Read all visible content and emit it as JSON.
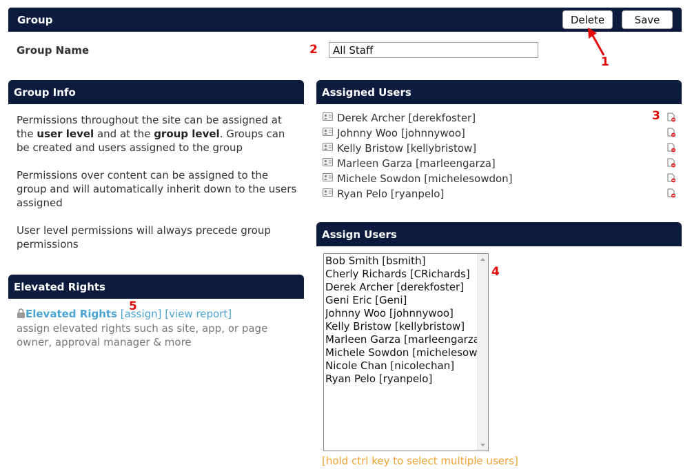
{
  "header": {
    "title": "Group",
    "delete_label": "Delete",
    "save_label": "Save"
  },
  "group_name": {
    "label": "Group Name",
    "value": "All Staff"
  },
  "group_info": {
    "title": "Group Info",
    "p1_a": "Permissions throughout the site can be assigned at the ",
    "p1_b": "user level",
    "p1_c": " and at the ",
    "p1_d": "group level",
    "p1_e": ". Groups can be created and users assigned to the group",
    "p2": "Permissions over content can be assigned to the group and will automatically inherit down to the users assigned",
    "p3": "User level permissions will always precede group permissions"
  },
  "elevated_rights": {
    "title": "Elevated Rights",
    "link_title": "Elevated Rights",
    "assign_link": "[assign]",
    "report_link": "[view report]",
    "description": "assign elevated rights such as site, app, or page owner, approval manager & more",
    "lock_icon": "lock-icon"
  },
  "assigned_users": {
    "title": "Assigned Users",
    "users": [
      "Derek Archer [derekfoster]",
      "Johnny Woo [johnnywoo]",
      "Kelly Bristow [kellybristow]",
      "Marleen Garza [marleengarza]",
      "Michele Sowdon [michelesowdon]",
      "Ryan Pelo [ryanpelo]"
    ],
    "user_icon": "user-card-icon",
    "remove_icon": "remove-user-icon"
  },
  "assign_users": {
    "title": "Assign Users",
    "options": [
      "Bob Smith [bsmith]",
      "Cherly Richards [CRichards]",
      "Derek Archer [derekfoster]",
      "Geni Eric [Geni]",
      "Johnny Woo [johnnywoo]",
      "Kelly Bristow [kellybristow]",
      "Marleen Garza [marleengarza]",
      "Michele Sowdon [michelesowdon]",
      "Nicole Chan [nicolechan]",
      "Ryan Pelo [ryanpelo]"
    ],
    "hint": "[hold ctrl key to select multiple users]"
  },
  "annotations": [
    "1",
    "2",
    "3",
    "4",
    "5"
  ],
  "colors": {
    "bar": "#0c1a3e",
    "annotation": "#e30a0a",
    "link": "#4aa3d0",
    "hint": "#f0a030"
  }
}
